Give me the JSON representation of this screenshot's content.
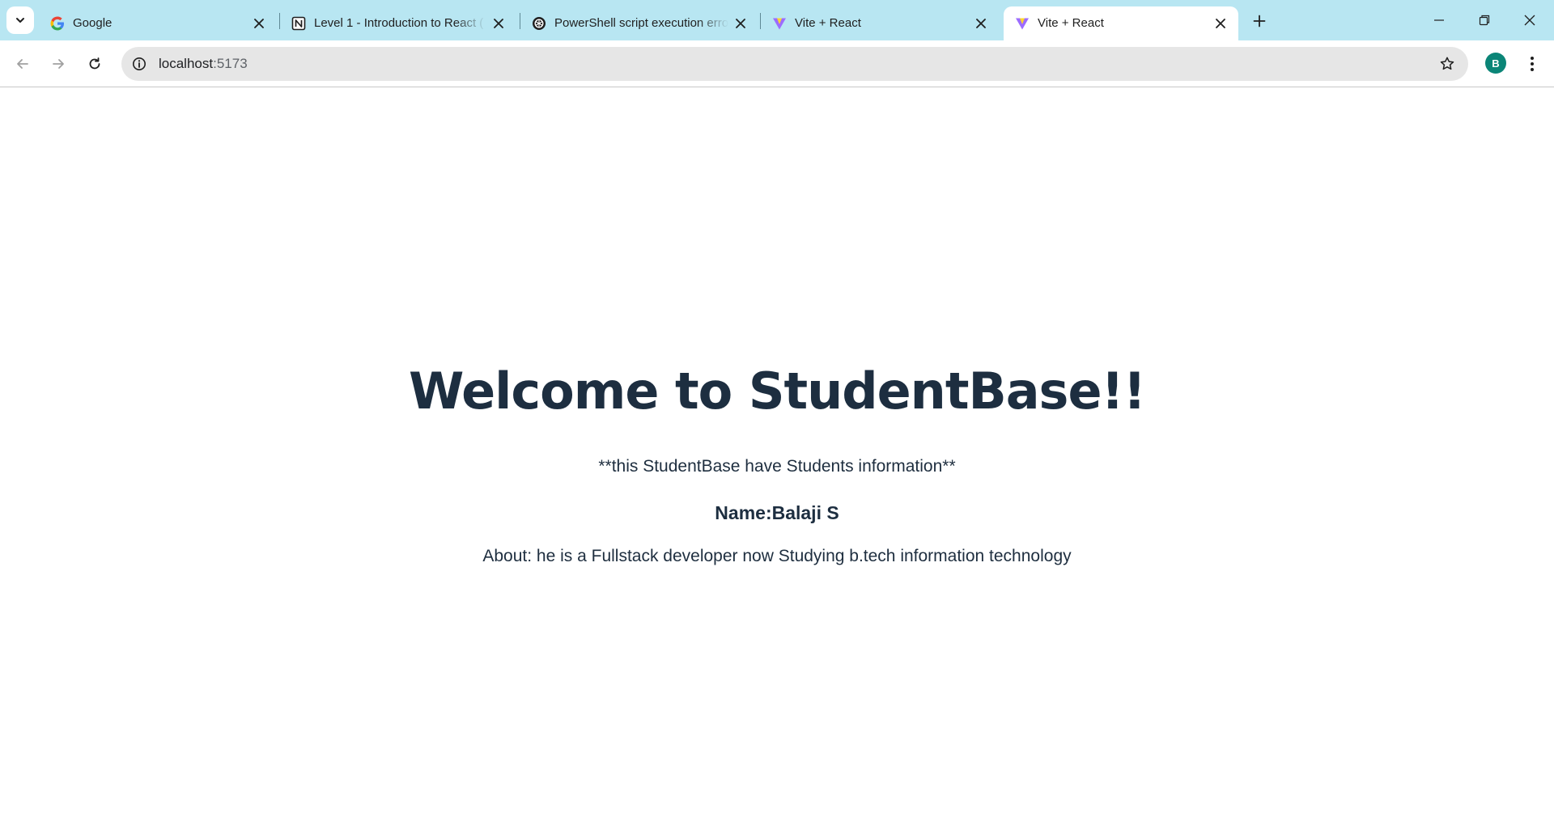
{
  "browser": {
    "tabs": [
      {
        "title": "Google",
        "favicon": "google-icon",
        "active": false
      },
      {
        "title": "Level 1 - Introduction to React (",
        "favicon": "notion-icon",
        "active": false
      },
      {
        "title": "PowerShell script execution erro",
        "favicon": "chatgpt-icon",
        "active": false
      },
      {
        "title": "Vite + React",
        "favicon": "vite-icon",
        "active": false
      },
      {
        "title": "Vite + React",
        "favicon": "vite-icon",
        "active": true
      }
    ],
    "address_bar": {
      "host": "localhost",
      "port": ":5173"
    },
    "profile_initial": "B",
    "accent_colors": {
      "tabstrip_bg": "#b8e6f2",
      "avatar_bg": "#0b8577",
      "text_dark": "#1d2e40"
    }
  },
  "page": {
    "title": "Welcome to StudentBase!!",
    "tagline": "**this StudentBase have Students information**",
    "name_line": "Name:Balaji S",
    "about_line": "About: he is a Fullstack developer now Studying b.tech information technology"
  }
}
